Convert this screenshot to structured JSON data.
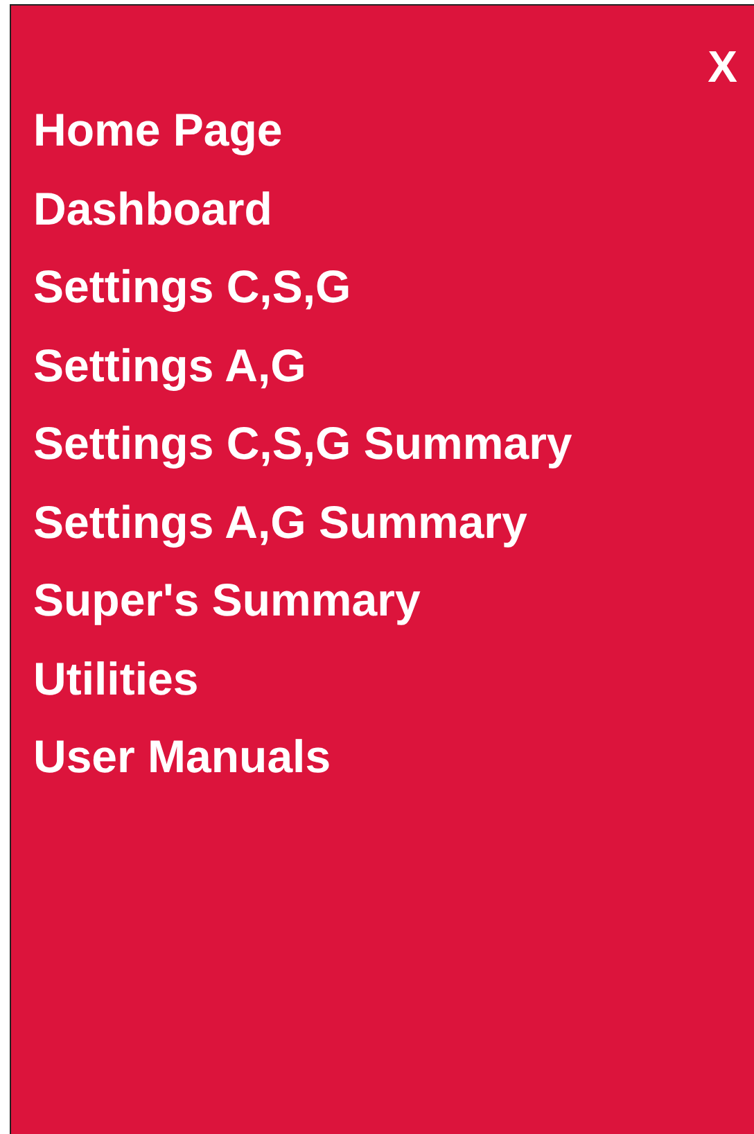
{
  "close_button": "X",
  "menu_items": [
    {
      "label": "Home Page"
    },
    {
      "label": "Dashboard"
    },
    {
      "label": "Settings C,S,G"
    },
    {
      "label": "Settings A,G"
    },
    {
      "label": "Settings C,S,G Summary"
    },
    {
      "label": "Settings A,G Summary"
    },
    {
      "label": "Super's Summary"
    },
    {
      "label": "Utilities"
    },
    {
      "label": "User Manuals"
    }
  ]
}
